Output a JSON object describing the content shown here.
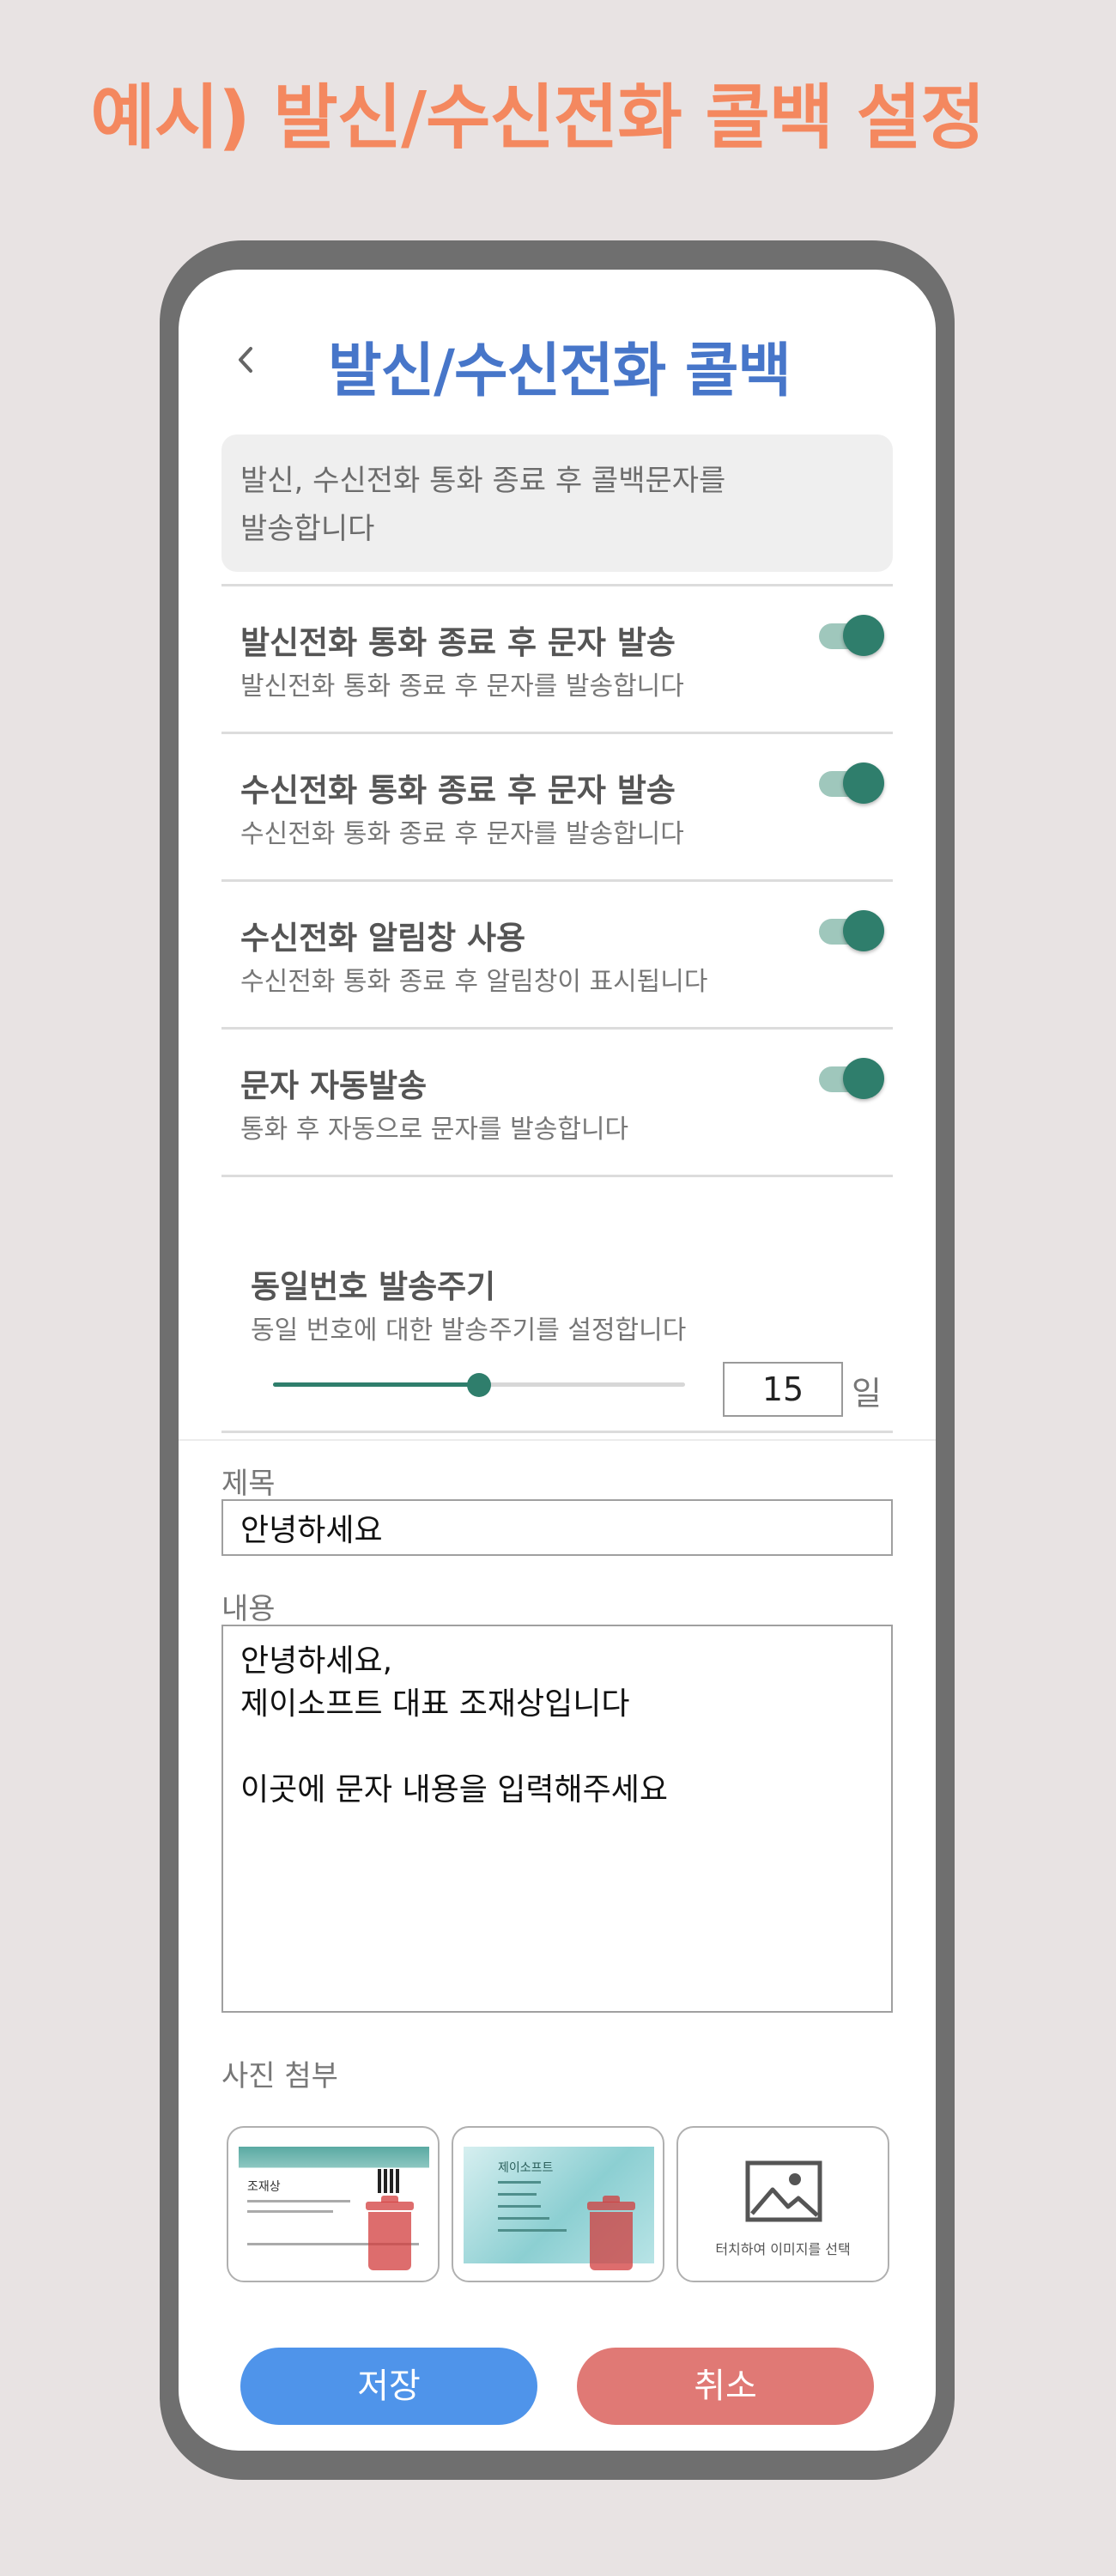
{
  "headline": "예시) 발신/수신전화 콜백 설정",
  "appbar": {
    "title": "발신/수신전화 콜백",
    "back_icon": "chevron-left-icon"
  },
  "info": {
    "line1": "발신, 수신전화 통화 종료 후 콜백문자를",
    "line2": "발송합니다"
  },
  "settings": [
    {
      "title": "발신전화 통화 종료 후 문자 발송",
      "desc": "발신전화 통화 종료 후 문자를 발송합니다",
      "enabled": true
    },
    {
      "title": "수신전화 통화 종료 후 문자 발송",
      "desc": "수신전화 통화 종료 후 문자를 발송합니다",
      "enabled": true
    },
    {
      "title": "수신전화 알림창 사용",
      "desc": "수신전화 통화 종료 후 알림창이 표시됩니다",
      "enabled": true
    },
    {
      "title": "문자 자동발송",
      "desc": "통화 후 자동으로 문자를 발송합니다",
      "enabled": true
    }
  ],
  "frequency": {
    "title": "동일번호 발송주기",
    "desc": "동일 번호에 대한 발송주기를 설정합니다",
    "value": "15",
    "unit": "일",
    "slider_fraction": 0.5
  },
  "subject": {
    "label": "제목",
    "value": "안녕하세요"
  },
  "content": {
    "label": "내용",
    "value": "안녕하세요,\n제이소프트 대표 조재상입니다\n\n이곳에 문자 내용을 입력해주세요"
  },
  "photos": {
    "label": "사진 첨부",
    "card1_name": "조재상",
    "card2_name": "제이소프트",
    "placeholder_text": "터치하여 이미지를 선택",
    "delete_icon": "trash-icon",
    "add_icon": "image-icon"
  },
  "buttons": {
    "save": "저장",
    "cancel": "취소"
  },
  "colors": {
    "headline": "#f4885f",
    "title": "#4776c9",
    "toggle_on": "#2f7e6c",
    "save": "#4f94ea",
    "cancel": "#e07975"
  }
}
